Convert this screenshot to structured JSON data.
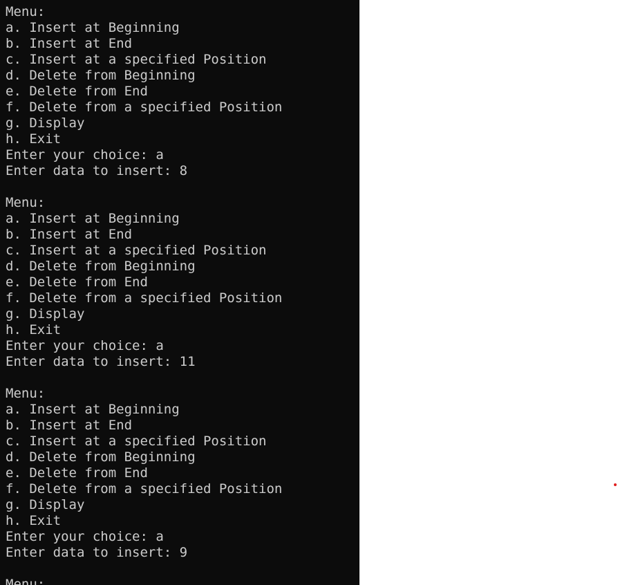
{
  "terminal": {
    "lines": [
      "Menu:",
      "a. Insert at Beginning",
      "b. Insert at End",
      "c. Insert at a specified Position",
      "d. Delete from Beginning",
      "e. Delete from End",
      "f. Delete from a specified Position",
      "g. Display",
      "h. Exit",
      "Enter your choice: a",
      "Enter data to insert: 8",
      "",
      "Menu:",
      "a. Insert at Beginning",
      "b. Insert at End",
      "c. Insert at a specified Position",
      "d. Delete from Beginning",
      "e. Delete from End",
      "f. Delete from a specified Position",
      "g. Display",
      "h. Exit",
      "Enter your choice: a",
      "Enter data to insert: 11",
      "",
      "Menu:",
      "a. Insert at Beginning",
      "b. Insert at End",
      "c. Insert at a specified Position",
      "d. Delete from Beginning",
      "e. Delete from End",
      "f. Delete from a specified Position",
      "g. Display",
      "h. Exit",
      "Enter your choice: a",
      "Enter data to insert: 9",
      "",
      "Menu:"
    ],
    "colors": {
      "background": "#0c0c0c",
      "text": "#cccccc",
      "page_background": "#ffffff",
      "marker": "#e02020"
    }
  }
}
